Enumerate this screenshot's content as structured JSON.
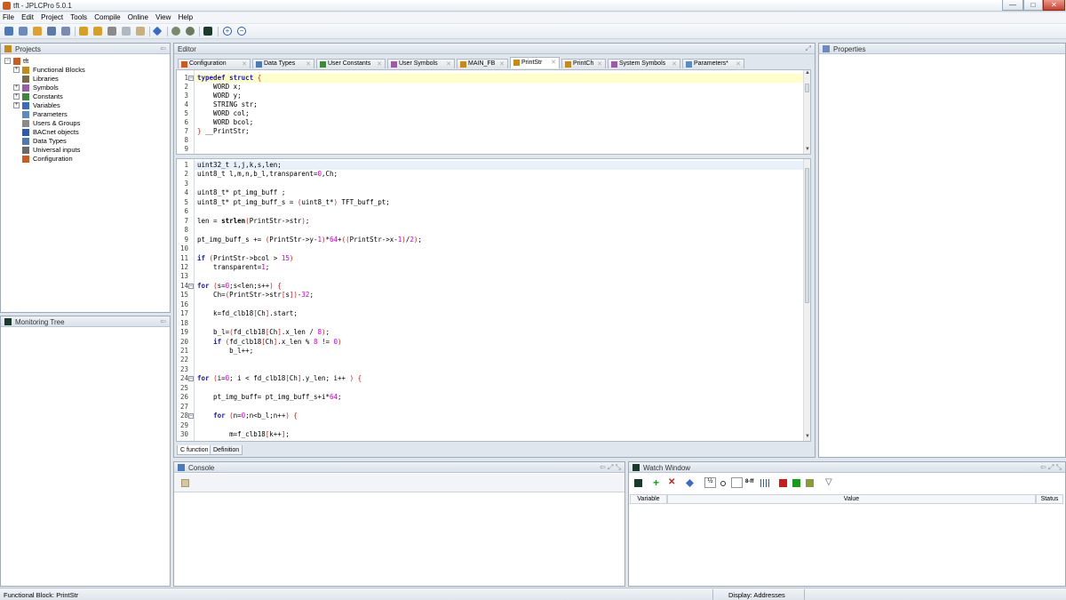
{
  "window": {
    "title": "tft - JPLCPro 5.0.1",
    "buttons": {
      "minimize": "—",
      "maximize": "□",
      "close": "✕"
    }
  },
  "menu": [
    "File",
    "Edit",
    "Project",
    "Tools",
    "Compile",
    "Online",
    "View",
    "Help"
  ],
  "projects_panel": {
    "title": "Projects",
    "root": "tft",
    "items": [
      {
        "label": "Functional Blocks",
        "expander": "+",
        "icon_color": "#c88a16"
      },
      {
        "label": "Libraries",
        "expander": "",
        "icon_color": "#7a6a4a"
      },
      {
        "label": "Symbols",
        "expander": "+",
        "icon_color": "#9c5aa8"
      },
      {
        "label": "Constants",
        "expander": "+",
        "icon_color": "#3a8a3a"
      },
      {
        "label": "Variables",
        "expander": "+",
        "icon_color": "#3a6ac8"
      },
      {
        "label": "Parameters",
        "expander": "",
        "icon_color": "#5a8ac8"
      },
      {
        "label": "Users & Groups",
        "expander": "",
        "icon_color": "#8a8a8a"
      },
      {
        "label": "BACnet objects",
        "expander": "",
        "icon_color": "#2a5ab8"
      },
      {
        "label": "Data Types",
        "expander": "",
        "icon_color": "#4a7ab8"
      },
      {
        "label": "Universal inputs",
        "expander": "",
        "icon_color": "#6a6a6a"
      },
      {
        "label": "Configuration",
        "expander": "",
        "icon_color": "#d05a1a"
      }
    ]
  },
  "monitoring_panel": {
    "title": "Monitoring Tree"
  },
  "editor": {
    "title": "Editor",
    "tabs": [
      {
        "label": "Configuration",
        "active": false
      },
      {
        "label": "Data Types",
        "active": false
      },
      {
        "label": "User Constants",
        "active": false
      },
      {
        "label": "User Symbols",
        "active": false
      },
      {
        "label": "MAIN_FB",
        "active": false
      },
      {
        "label": "PrintStr",
        "active": true
      },
      {
        "label": "PrintCh",
        "active": false
      },
      {
        "label": "System Symbols",
        "active": false
      },
      {
        "label": "Parameters*",
        "active": false
      }
    ],
    "close_glyph": "✕",
    "struct_lines": [
      "typedef struct {",
      "    WORD x;",
      "    WORD y;",
      "    STRING str;",
      "    WORD col;",
      "    WORD bcol;",
      "} __PrintStr;",
      "",
      ""
    ],
    "code_lines": [
      "uint32_t i,j,k,s,len;",
      "uint8_t l,m,n,b_l,transparent=0,Ch;",
      "",
      "uint8_t* pt_img_buff ;",
      "uint8_t* pt_img_buff_s = (uint8_t*) TFT_buff_pt;",
      "",
      "len = strlen(PrintStr->str);",
      "",
      "pt_img_buff_s += (PrintStr->y-1)*64+((PrintStr->x-1)/2);",
      "",
      "if (PrintStr->bcol > 15)",
      "    transparent=1;",
      "",
      "for (s=0;s<len;s++) {",
      "    Ch=(PrintStr->str[s])-32;",
      "",
      "    k=fd_clb18[Ch].start;",
      "",
      "    b_l=(fd_clb18[Ch].x_len / 8);",
      "    if (fd_clb18[Ch].x_len % 8 != 0)",
      "        b_l++;",
      "",
      "",
      "for (i=0; i < fd_clb18[Ch].y_len; i++ ) {",
      "",
      "    pt_img_buff= pt_img_buff_s+i*64;",
      "",
      "    for (n=0;n<b_l;n++) {",
      "",
      "        m=f_clb18[k++];"
    ],
    "bottom_tabs": [
      {
        "label": "C function",
        "active": true
      },
      {
        "label": "Definition",
        "active": false
      }
    ]
  },
  "properties_panel": {
    "title": "Properties"
  },
  "console_panel": {
    "title": "Console"
  },
  "watch_panel": {
    "title": "Watch Window",
    "columns": [
      "Variable",
      "Value",
      "Status"
    ],
    "toolbar_text": {
      "fraction": "½",
      "bits": "8-ff"
    }
  },
  "status_bar": {
    "left": "Functional Block: PrintStr",
    "right": "Display: Addresses"
  }
}
